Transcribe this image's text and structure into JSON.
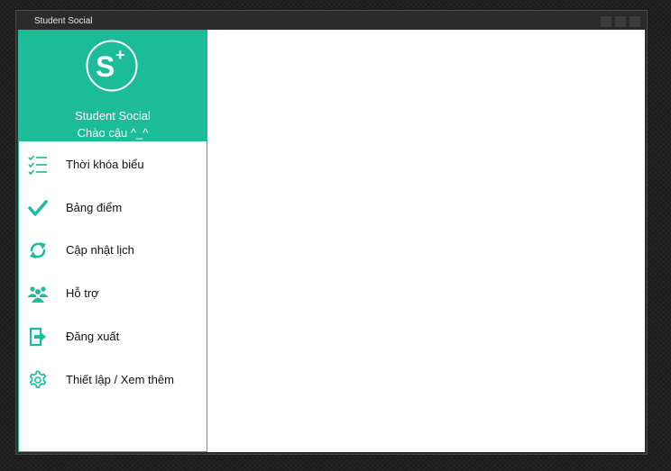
{
  "window": {
    "title": "Student Social"
  },
  "sidebar": {
    "accent_color": "#1dbc98",
    "app_name": "Student Social",
    "greeting": "Chào cậu ^_^",
    "logo": {
      "letter": "S",
      "superscript": "+"
    },
    "items": [
      {
        "label": "Thời khóa biểu",
        "icon": "checklist-icon"
      },
      {
        "label": "Bảng điểm",
        "icon": "checkmark-icon"
      },
      {
        "label": "Cập nhật lịch",
        "icon": "refresh-icon"
      },
      {
        "label": "Hỗ trợ",
        "icon": "group-icon"
      },
      {
        "label": "Đăng xuất",
        "icon": "logout-icon"
      },
      {
        "label": "Thiết lập / Xem thêm",
        "icon": "gear-icon"
      }
    ]
  }
}
